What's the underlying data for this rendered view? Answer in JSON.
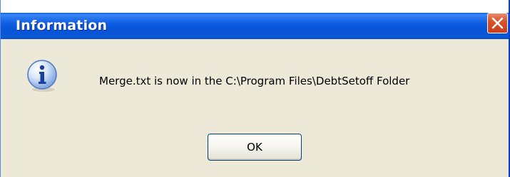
{
  "window": {
    "title": "Information",
    "close_icon": "close-x-icon",
    "title_gradient": "#0a5ae0",
    "close_color": "#d8532c"
  },
  "message": {
    "icon": "information-icon",
    "text": "Merge.txt is now in the C:\\Program Files\\DebtSetoff Folder"
  },
  "buttons": {
    "ok_label": "OK"
  }
}
